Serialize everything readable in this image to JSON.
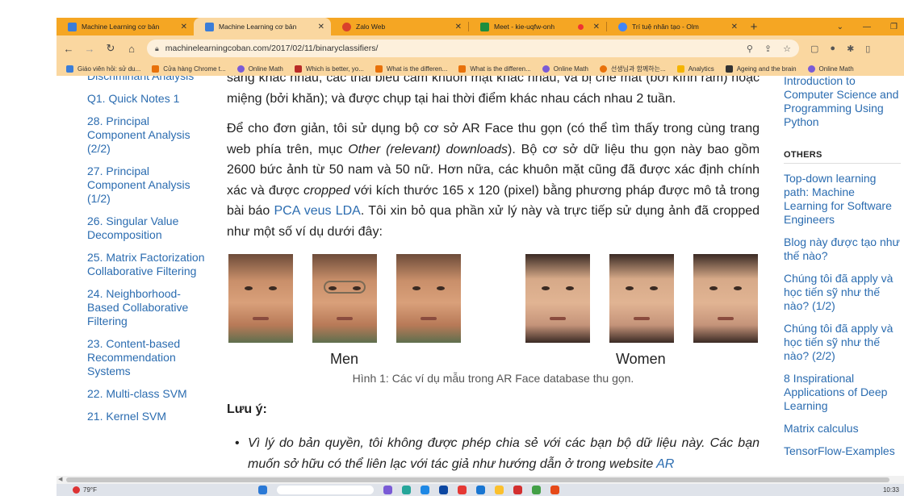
{
  "browser": {
    "tabs": [
      {
        "title": "Machine Learning cơ bản",
        "color": "#3b7dd8",
        "active": false
      },
      {
        "title": "Machine Learning cơ bản",
        "color": "#3b7dd8",
        "active": true
      },
      {
        "title": "Zalo Web",
        "color": "#d9412b",
        "active": false
      },
      {
        "title": "Meet - kie-uqfw-onh",
        "color": "#1e8e3e",
        "active": false
      },
      {
        "title": "Trí tuệ nhân tạo - Olm",
        "color": "#4285f4",
        "active": false
      }
    ],
    "new_tab": "+",
    "url": "machinelearningcoban.com/2017/02/11/binaryclassifiers/",
    "bookmarks": [
      {
        "label": "Giáo viên hỏi: sử du...",
        "color": "#3b7dd8"
      },
      {
        "label": "Cửa hàng Chrome t...",
        "color": "#e8710a"
      },
      {
        "label": "Online Math",
        "color": "#7a5bd6"
      },
      {
        "label": "Which is better, yo...",
        "color": "#b92b27"
      },
      {
        "label": "What is the differen...",
        "color": "#e8710a"
      },
      {
        "label": "What is the differen...",
        "color": "#e8710a"
      },
      {
        "label": "Online Math",
        "color": "#7a5bd6"
      },
      {
        "label": "선생님과 함께하는...",
        "color": "#e8710a"
      },
      {
        "label": "Analytics",
        "color": "#f4b400"
      },
      {
        "label": "Ageing and the brain",
        "color": "#333333"
      },
      {
        "label": "Online Math",
        "color": "#7a5bd6"
      }
    ]
  },
  "left_nav": [
    "Discriminant Analysis",
    "Q1. Quick Notes 1",
    "28. Principal Component Analysis (2/2)",
    "27. Principal Component Analysis (1/2)",
    "26. Singular Value Decomposition",
    "25. Matrix Factorization Collaborative Filtering",
    "24. Neighborhood-Based Collaborative Filtering",
    "23. Content-based Recommendation Systems",
    "22. Multi-class SVM",
    "21. Kernel SVM"
  ],
  "article": {
    "p0": "sáng khác nhau, các thái biểu cảm khuôn mặt khác nhau, và bị che mắt (bởi kính râm) hoặc miệng (bởi khăn); và được chụp tại hai thời điểm khác nhau cách nhau 2 tuần.",
    "p1_a": "Để cho đơn giản, tôi sử dụng bộ cơ sở AR Face thu gọn (có thể tìm thấy trong cùng trang web phía trên, mục ",
    "p1_em1": "Other (relevant) downloads",
    "p1_b": "). Bộ cơ sở dữ liệu thu gọn này bao gồm 2600 bức ảnh từ 50 nam và 50 nữ. Hơn nữa, các khuôn mặt cũng đã được xác định chính xác và được ",
    "p1_em2": "cropped",
    "p1_c": " với kích thước 165 x 120 (pixel) bằng phương pháp được mô tả trong bài báo ",
    "p1_link": "PCA veus LDA",
    "p1_d": ". Tôi xin bỏ qua phần xử lý này và trực tiếp sử dụng ảnh đã cropped như một số ví dụ dưới đây:",
    "men_label": "Men",
    "women_label": "Women",
    "figure_caption": "Hình 1: Các ví dụ mẫu trong AR Face database thu gọn.",
    "note_heading": "Lưu ý:",
    "note_bullet": "Vì lý do bản quyền, tôi không được phép chia sẻ với các bạn bộ dữ liệu này. Các bạn muốn sở hữu có thể liên lạc với tác giả như hướng dẫn ở trong website ",
    "note_link": "AR"
  },
  "right_nav": {
    "top_items": [
      "Introduction to Computer Science and Programming Using Python"
    ],
    "others_heading": "OTHERS",
    "others_items": [
      "Top-down learning path: Machine Learning for Software Engineers",
      "Blog này được tạo như thế nào?",
      "Chúng tôi đã apply và học tiến sỹ như thế nào? (1/2)",
      "Chúng tôi đã apply và học tiến sỹ như thế nào? (2/2)",
      "8 Inspirational Applications of Deep Learning",
      "Matrix calculus",
      "TensorFlow-Examples"
    ]
  },
  "taskbar": {
    "weather": "79°F",
    "clock": "10:33"
  }
}
